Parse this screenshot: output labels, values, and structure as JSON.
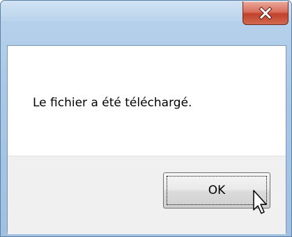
{
  "dialog": {
    "message": "Le fichier a été téléchargé.",
    "ok_label": "OK",
    "close_icon": "close-icon",
    "cursor_icon": "arrow-cursor-icon"
  },
  "colors": {
    "frame": "#a9c8e6",
    "close_button": "#c2412c",
    "button_area": "#f0f0f0"
  }
}
